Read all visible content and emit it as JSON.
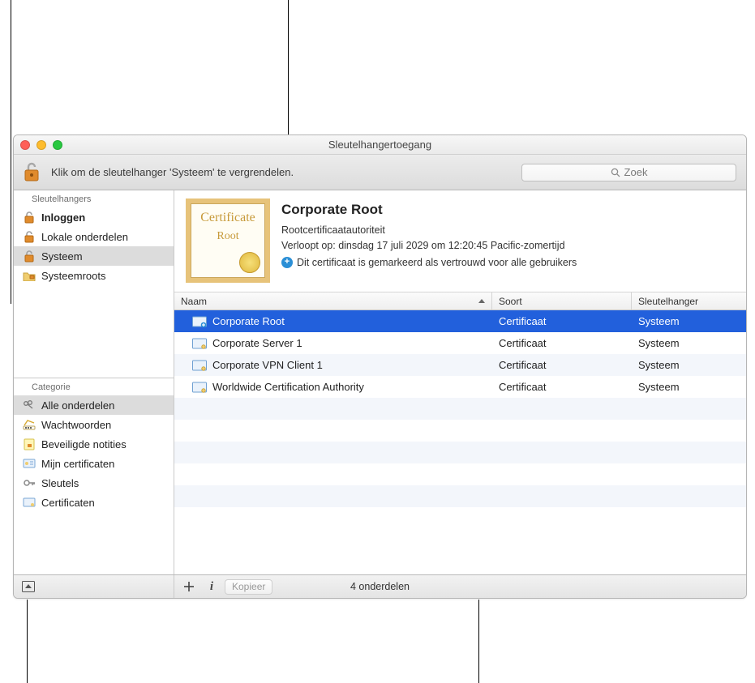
{
  "window_title": "Sleutelhangertoegang",
  "toolbar": {
    "lock_hint": "Klik om de sleutelhanger 'Systeem' te vergrendelen.",
    "search_placeholder": "Zoek"
  },
  "sidebar": {
    "keychains_header": "Sleutelhangers",
    "keychains": [
      {
        "label": "Inloggen",
        "icon": "unlock",
        "bold": true
      },
      {
        "label": "Lokale onderdelen",
        "icon": "unlock",
        "bold": false
      },
      {
        "label": "Systeem",
        "icon": "unlock",
        "bold": false,
        "selected": true
      },
      {
        "label": "Systeemroots",
        "icon": "folder-lock",
        "bold": false
      }
    ],
    "category_header": "Categorie",
    "categories": [
      {
        "label": "Alle onderdelen",
        "icon": "keys",
        "selected": true
      },
      {
        "label": "Wachtwoorden",
        "icon": "passwords"
      },
      {
        "label": "Beveiligde notities",
        "icon": "secure-note"
      },
      {
        "label": "Mijn certificaten",
        "icon": "my-cert"
      },
      {
        "label": "Sleutels",
        "icon": "key"
      },
      {
        "label": "Certificaten",
        "icon": "cert"
      }
    ]
  },
  "preview": {
    "badge_line1": "Certificate",
    "badge_line2": "Root",
    "title": "Corporate Root",
    "authority": "Rootcertificaatautoriteit",
    "expires": "Verloopt op: dinsdag 17 juli 2029 om 12:20:45 Pacific-zomertijd",
    "trust": "Dit certificaat is gemarkeerd als vertrouwd voor alle gebruikers"
  },
  "table": {
    "headers": {
      "name": "Naam",
      "kind": "Soort",
      "keychain": "Sleutelhanger"
    },
    "rows": [
      {
        "name": "Corporate Root",
        "kind": "Certificaat",
        "keychain": "Systeem",
        "selected": true,
        "plus": true
      },
      {
        "name": "Corporate Server 1",
        "kind": "Certificaat",
        "keychain": "Systeem"
      },
      {
        "name": "Corporate VPN Client 1",
        "kind": "Certificaat",
        "keychain": "Systeem"
      },
      {
        "name": "Worldwide Certification Authority",
        "kind": "Certificaat",
        "keychain": "Systeem"
      }
    ]
  },
  "bottom": {
    "copy_label": "Kopieer",
    "count": "4 onderdelen"
  }
}
